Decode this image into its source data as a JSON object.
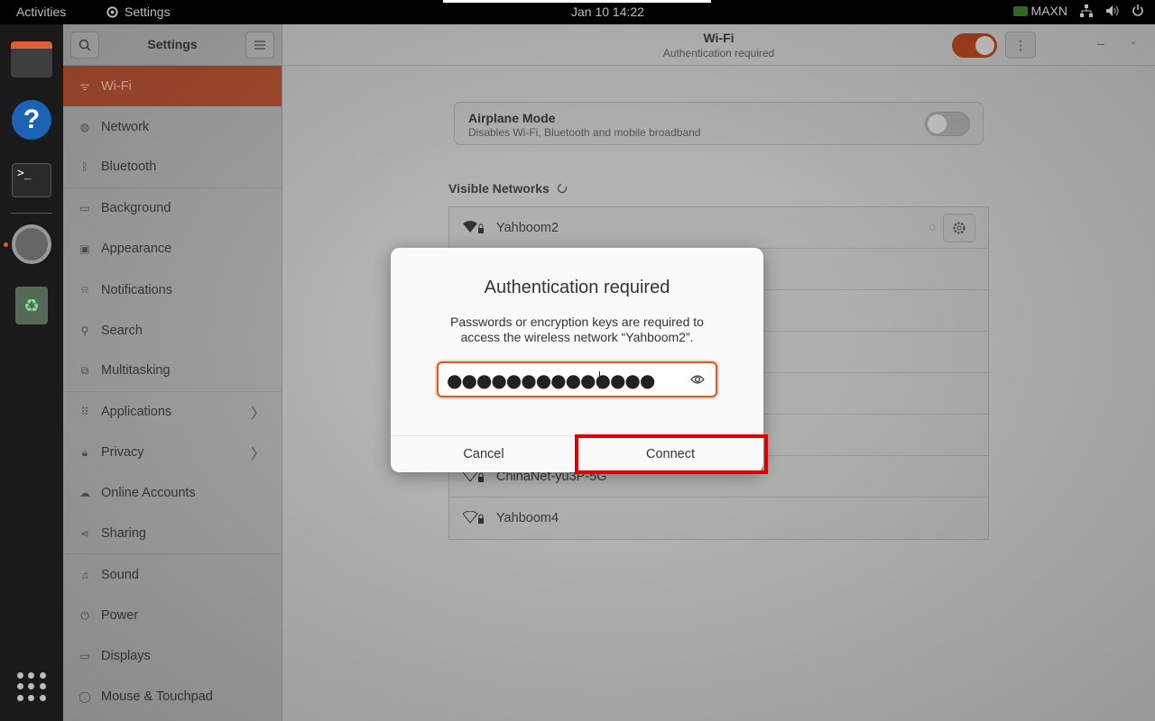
{
  "topbar": {
    "activities": "Activities",
    "app_name": "Settings",
    "clock": "Jan 10  14:22",
    "nvidia_label": "MAXN"
  },
  "dock": {
    "items": [
      "files",
      "help",
      "terminal",
      "settings",
      "trash"
    ]
  },
  "sidebar": {
    "title": "Settings",
    "items": [
      {
        "label": "Wi-Fi",
        "icon": "wifi-icon"
      },
      {
        "label": "Network",
        "icon": "network-icon"
      },
      {
        "label": "Bluetooth",
        "icon": "bluetooth-icon"
      },
      {
        "label": "Background",
        "icon": "background-icon"
      },
      {
        "label": "Appearance",
        "icon": "appearance-icon"
      },
      {
        "label": "Notifications",
        "icon": "bell-icon"
      },
      {
        "label": "Search",
        "icon": "search-icon"
      },
      {
        "label": "Multitasking",
        "icon": "multitasking-icon"
      },
      {
        "label": "Applications",
        "icon": "grid-icon"
      },
      {
        "label": "Privacy",
        "icon": "lock-icon"
      },
      {
        "label": "Online Accounts",
        "icon": "cloud-icon"
      },
      {
        "label": "Sharing",
        "icon": "share-icon"
      },
      {
        "label": "Sound",
        "icon": "music-note-icon"
      },
      {
        "label": "Power",
        "icon": "power-icon"
      },
      {
        "label": "Displays",
        "icon": "display-icon"
      },
      {
        "label": "Mouse & Touchpad",
        "icon": "mouse-icon"
      }
    ]
  },
  "header": {
    "title": "Wi-Fi",
    "subtitle": "Authentication required"
  },
  "airplane": {
    "title": "Airplane Mode",
    "subtitle": "Disables Wi-Fi, Bluetooth and mobile broadband"
  },
  "networks": {
    "title": "Visible Networks",
    "rows": [
      {
        "name": "Yahboom2"
      },
      {
        "name": ""
      },
      {
        "name": ""
      },
      {
        "name": ""
      },
      {
        "name": ""
      },
      {
        "name": ""
      },
      {
        "name": "ChinaNet-yu3P-5G"
      },
      {
        "name": "Yahboom4"
      }
    ]
  },
  "dialog": {
    "title": "Authentication required",
    "message_line1": "Passwords or encryption keys are required to",
    "message_line2": "access the wireless network “Yahboom2”.",
    "password_mask": "●●●●●●●●●●●●●●",
    "cancel_label": "Cancel",
    "connect_label": "Connect"
  },
  "colors": {
    "accent": "#e95420",
    "highlight": "#e00000"
  }
}
